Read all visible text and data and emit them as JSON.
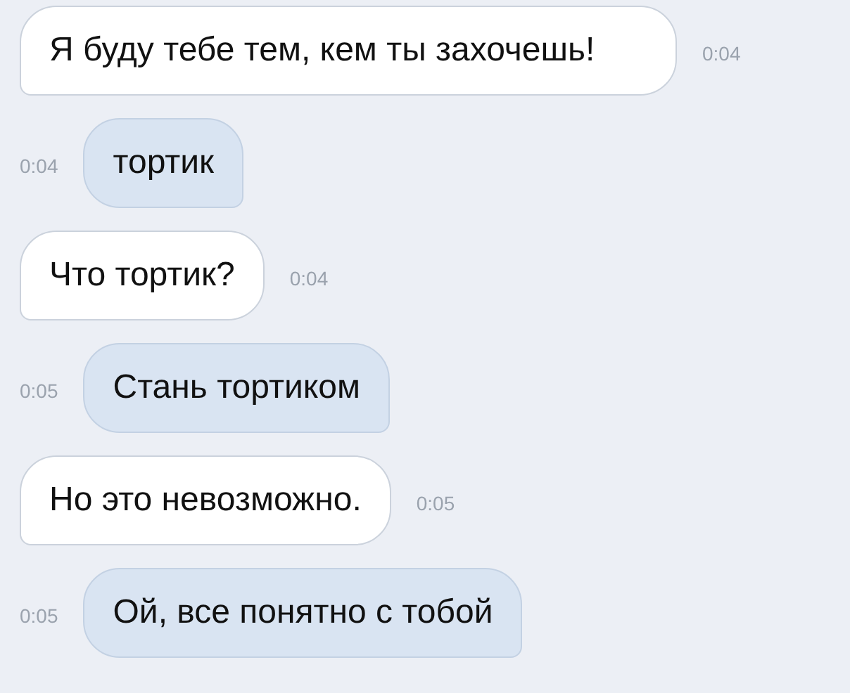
{
  "messages": [
    {
      "kind": "incoming",
      "text": "Я буду тебе тем, кем ты захочешь!",
      "time": "0:04"
    },
    {
      "kind": "outgoing",
      "text": "тортик",
      "time": "0:04"
    },
    {
      "kind": "incoming",
      "text": "Что тортик?",
      "time": "0:04"
    },
    {
      "kind": "outgoing",
      "text": "Стань тортиком",
      "time": "0:05"
    },
    {
      "kind": "incoming",
      "text": "Но это невозможно.",
      "time": "0:05"
    },
    {
      "kind": "outgoing",
      "text": "Ой, все понятно с тобой",
      "time": "0:05"
    }
  ]
}
